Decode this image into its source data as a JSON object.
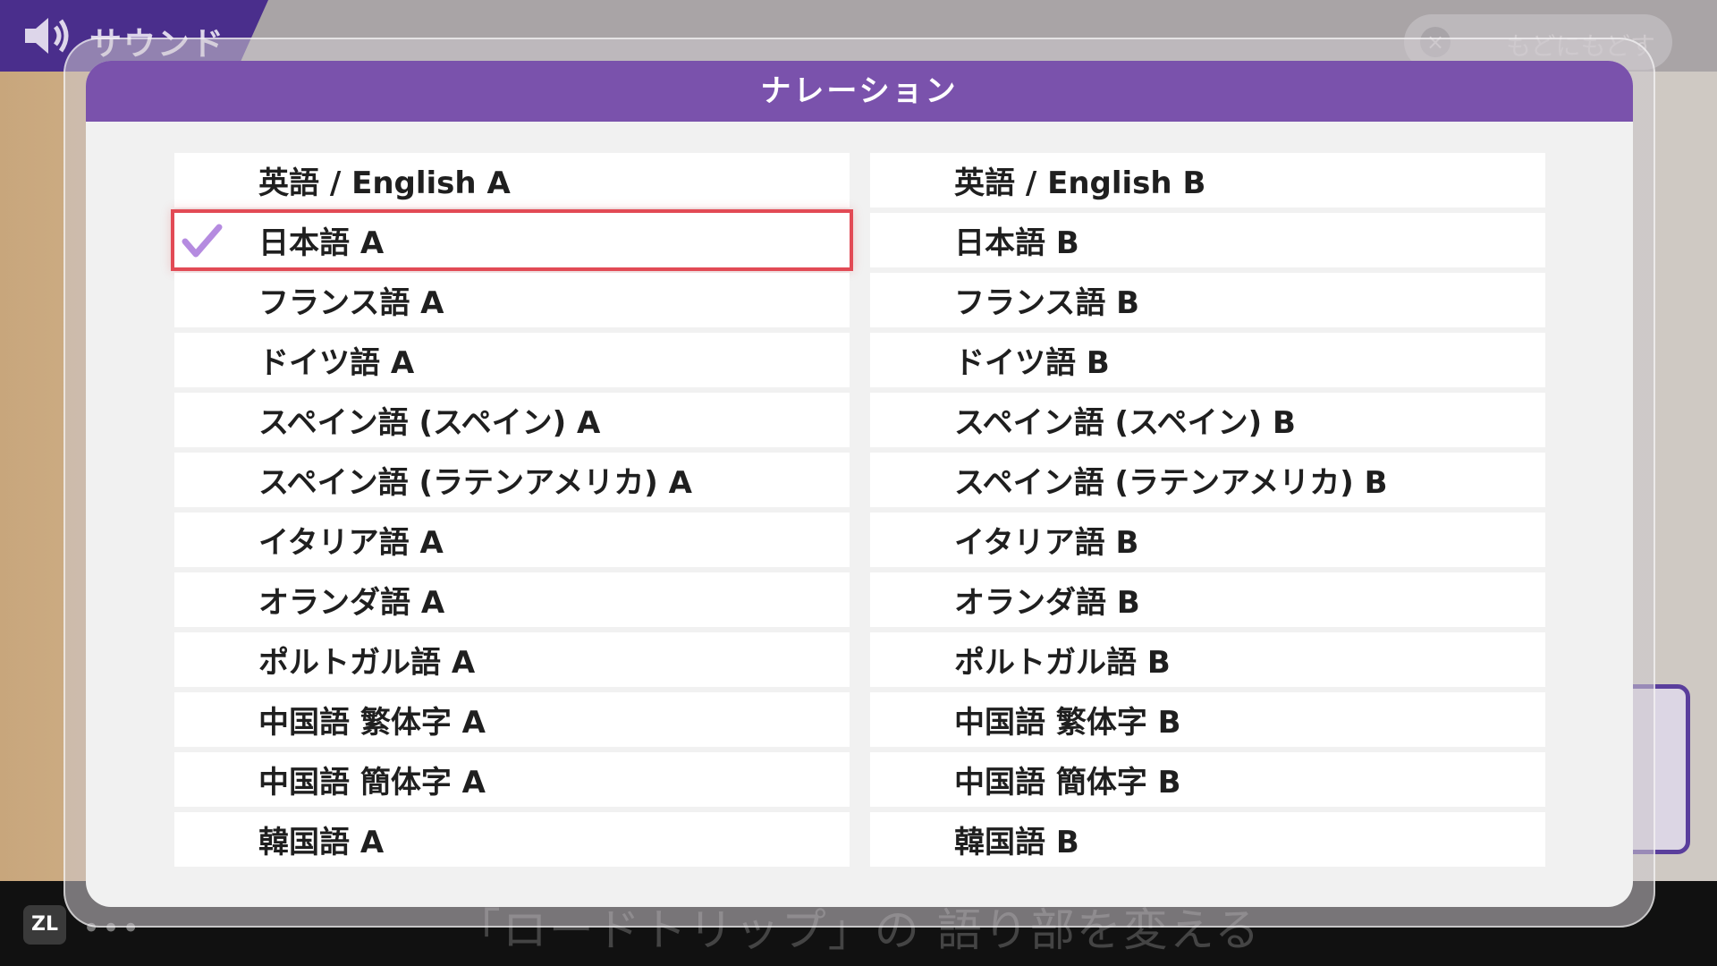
{
  "background": {
    "header_title": "サウンド",
    "back_button_label": "もどにもどす",
    "caption": "「ロードトリップ」の 語り部を変える",
    "zl_button_label": "ZL",
    "menu_dots": "•••",
    "back_icon": "×"
  },
  "dialog": {
    "title": "ナレーション",
    "selected_option": "日本語 A",
    "accent_color": "#7a52ac",
    "selection_color": "#e24a55",
    "check_color": "#b58be0",
    "options_left": [
      {
        "label": "英語 / English A"
      },
      {
        "label": "日本語 A"
      },
      {
        "label": "フランス語 A"
      },
      {
        "label": "ドイツ語 A"
      },
      {
        "label": "スペイン語 (スペイン) A"
      },
      {
        "label": "スペイン語 (ラテンアメリカ) A"
      },
      {
        "label": "イタリア語 A"
      },
      {
        "label": "オランダ語 A"
      },
      {
        "label": "ポルトガル語 A"
      },
      {
        "label": "中国語 繁体字 A"
      },
      {
        "label": "中国語 簡体字 A"
      },
      {
        "label": "韓国語 A"
      }
    ],
    "options_right": [
      {
        "label": "英語 / English B"
      },
      {
        "label": "日本語 B"
      },
      {
        "label": "フランス語 B"
      },
      {
        "label": "ドイツ語 B"
      },
      {
        "label": "スペイン語 (スペイン) B"
      },
      {
        "label": "スペイン語 (ラテンアメリカ) B"
      },
      {
        "label": "イタリア語 B"
      },
      {
        "label": "オランダ語 B"
      },
      {
        "label": "ポルトガル語 B"
      },
      {
        "label": "中国語 繁体字 B"
      },
      {
        "label": "中国語 簡体字 B"
      },
      {
        "label": "韓国語 B"
      }
    ]
  },
  "icons": {
    "sound": "speaker-icon",
    "check": "checkmark-icon",
    "close": "close-icon"
  }
}
